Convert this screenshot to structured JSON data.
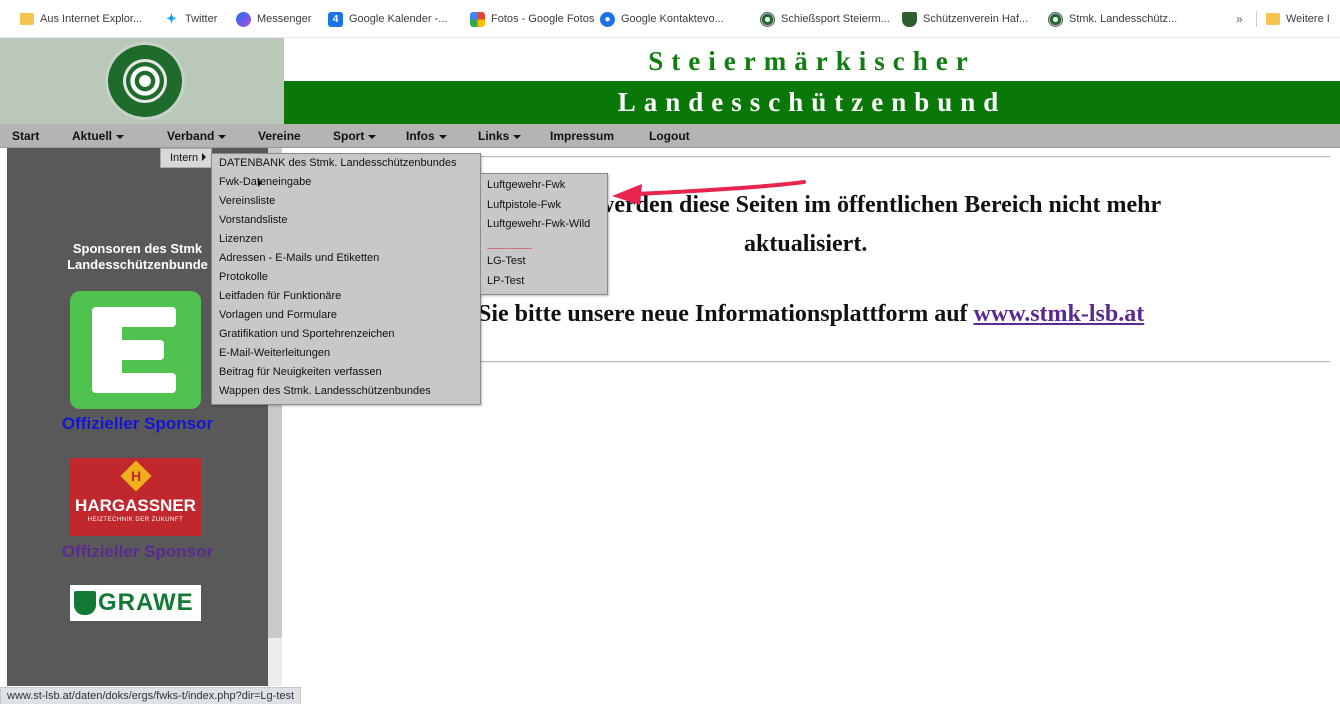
{
  "bookmarks": {
    "items": [
      {
        "label": "Aus Internet Explor...",
        "icon": "folder-icon"
      },
      {
        "label": "Twitter",
        "icon": "twitter-icon"
      },
      {
        "label": "Messenger",
        "icon": "messenger-icon"
      },
      {
        "label": "Google Kalender -...",
        "icon": "google-calendar-icon"
      },
      {
        "label": "Fotos - Google Fotos",
        "icon": "google-photos-icon"
      },
      {
        "label": "Google Kontaktevo...",
        "icon": "google-contacts-icon"
      },
      {
        "label": "Schießsport Steierm...",
        "icon": "target-icon"
      },
      {
        "label": "Schützenverein Haf...",
        "icon": "shield-icon"
      },
      {
        "label": "Stmk. Landesschütz...",
        "icon": "target-icon"
      }
    ],
    "more_label": "»",
    "other_label": "Weitere I"
  },
  "header": {
    "title_line1": "Steiermärkischer",
    "title_line2": "Landesschützenbund",
    "title_color": "#0f7d0f",
    "banner_color": "#097809"
  },
  "nav": {
    "items": [
      {
        "label": "Start",
        "has_dropdown": false
      },
      {
        "label": "Aktuell",
        "has_dropdown": true
      },
      {
        "label": "Verband",
        "has_dropdown": true
      },
      {
        "label": "Vereine",
        "has_dropdown": false
      },
      {
        "label": "Sport",
        "has_dropdown": true
      },
      {
        "label": "Infos",
        "has_dropdown": true
      },
      {
        "label": "Links",
        "has_dropdown": true
      },
      {
        "label": "Impressum",
        "has_dropdown": false
      },
      {
        "label": "Logout",
        "has_dropdown": false
      }
    ]
  },
  "menus": {
    "intern_label": "Intern",
    "level1": [
      "DATENBANK des Stmk. Landesschützenbundes",
      "Fwk-Dateneingabe",
      "Vereinsliste",
      "Vorstandsliste",
      "Lizenzen",
      "Adressen - E-Mails und Etiketten",
      "Protokolle",
      "Leitfaden für Funktionäre",
      "Vorlagen und Formulare",
      "Gratifikation und Sportehrenzeichen",
      "E-Mail-Weiterleitungen",
      "Beitrag für Neuigkeiten verfassen",
      "Wappen des Stmk. Landesschützenbundes"
    ],
    "level2": [
      "Luftgewehr-Fwk",
      "Luftpistole-Fwk",
      "Luftgewehr-Fwk-Wild",
      "---------------",
      "LG-Test",
      "LP-Test"
    ]
  },
  "sidebar": {
    "heading_line1": "Sponsoren des Stmk",
    "heading_line2": "Landesschützenbunde",
    "sponsor1_caption": "Offizieller Sponsor",
    "sponsor1_caption_color": "#1515d6",
    "sponsor2_logo_text": "HARGASSNER",
    "sponsor2_logo_sub": "HEIZTECHNIK DER ZUKUNFT",
    "sponsor2_logo_mark": "H",
    "sponsor2_caption": "Offizieller Sponsor",
    "sponsor2_caption_color": "#5b2a8f",
    "sponsor3_logo_text": "GRAWE"
  },
  "main": {
    "line1": "werden diese Seiten im öffentlichen Bereich nicht mehr",
    "line2": "aktualisiert.",
    "line3_prefix": "Sie bitte unsere neue Informationsplattform auf",
    "link_text": "www.stmk-lsb.at"
  },
  "status_bar": {
    "url": "www.st-lsb.at/daten/doks/ergs/fwks-t/index.php?dir=Lg-test"
  }
}
